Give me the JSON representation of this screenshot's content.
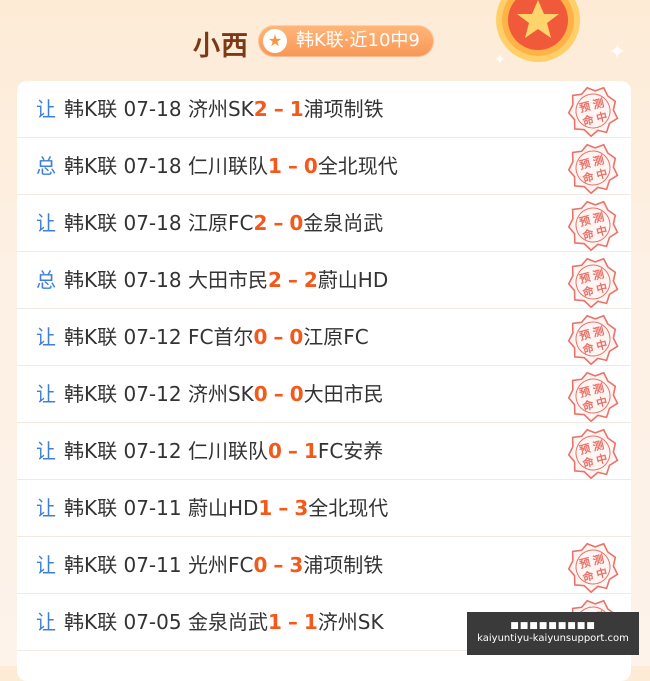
{
  "header": {
    "title": "小西",
    "badge_text": "韩K联·近10中9"
  },
  "stamp_text": "预测命中",
  "rows": [
    {
      "type": "让",
      "league": "韩K联",
      "date": "07-18",
      "home": "济州SK",
      "home_score": "2",
      "away_score": "1",
      "away": "浦项制铁",
      "stamp": true
    },
    {
      "type": "总",
      "league": "韩K联",
      "date": "07-18",
      "home": "仁川联队",
      "home_score": "1",
      "away_score": "0",
      "away": "全北现代",
      "stamp": true
    },
    {
      "type": "让",
      "league": "韩K联",
      "date": "07-18",
      "home": "江原FC",
      "home_score": "2",
      "away_score": "0",
      "away": "金泉尚武",
      "stamp": true
    },
    {
      "type": "总",
      "league": "韩K联",
      "date": "07-18",
      "home": "大田市民",
      "home_score": "2",
      "away_score": "2",
      "away": "蔚山HD",
      "stamp": true
    },
    {
      "type": "让",
      "league": "韩K联",
      "date": "07-12",
      "home": "FC首尔",
      "home_score": "0",
      "away_score": "0",
      "away": "江原FC",
      "stamp": true
    },
    {
      "type": "让",
      "league": "韩K联",
      "date": "07-12",
      "home": "济州SK",
      "home_score": "0",
      "away_score": "0",
      "away": "大田市民",
      "stamp": true
    },
    {
      "type": "让",
      "league": "韩K联",
      "date": "07-12",
      "home": "仁川联队",
      "home_score": "0",
      "away_score": "1",
      "away": "FC安养",
      "stamp": true
    },
    {
      "type": "让",
      "league": "韩K联",
      "date": "07-11",
      "home": "蔚山HD",
      "home_score": "1",
      "away_score": "3",
      "away": "全北现代",
      "stamp": false
    },
    {
      "type": "让",
      "league": "韩K联",
      "date": "07-11",
      "home": "光州FC",
      "home_score": "0",
      "away_score": "3",
      "away": "浦项制铁",
      "stamp": true
    },
    {
      "type": "让",
      "league": "韩K联",
      "date": "07-05",
      "home": "金泉尚武",
      "home_score": "1",
      "away_score": "1",
      "away": "济州SK",
      "stamp": true
    }
  ],
  "watermark": {
    "line1": "■■■■■■■■■",
    "line2": "kaiyuntiyu-kaiyunsupport.com"
  },
  "colors": {
    "accent": "#f2591a",
    "type_blue": "#3f7fd4",
    "stamp_red": "#e8736a",
    "title_brown": "#7a3a17"
  }
}
